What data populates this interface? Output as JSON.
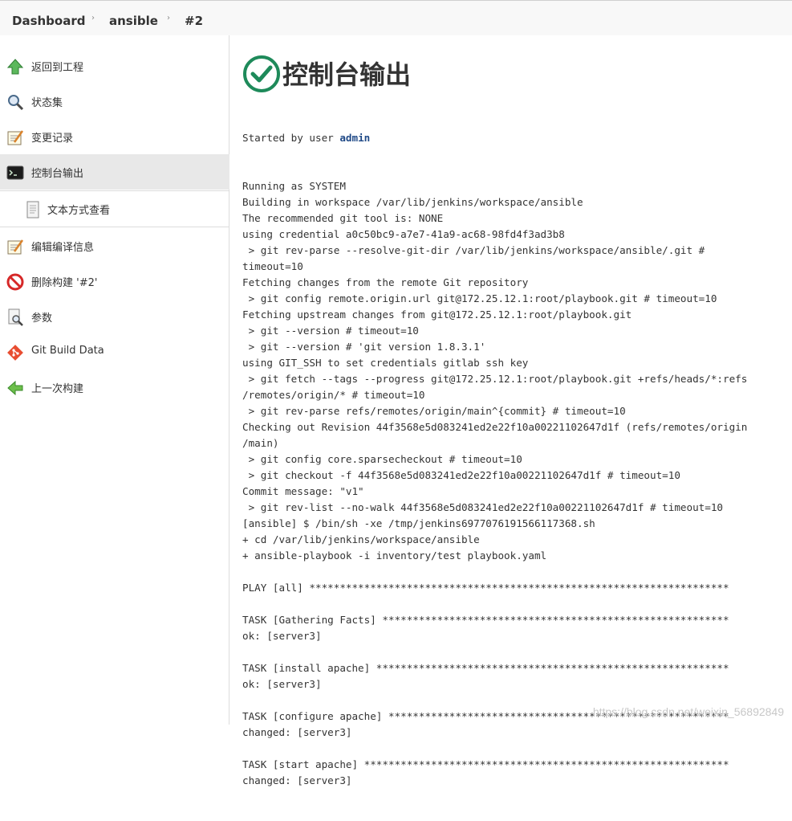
{
  "breadcrumb": {
    "items": [
      "Dashboard",
      "ansible",
      "#2"
    ],
    "separator": "›"
  },
  "sidebar": {
    "items": [
      {
        "label": "返回到工程",
        "icon": "up-arrow-icon"
      },
      {
        "label": "状态集",
        "icon": "magnifier-icon"
      },
      {
        "label": "变更记录",
        "icon": "notepad-icon"
      },
      {
        "label": "控制台输出",
        "icon": "terminal-icon",
        "active": true
      },
      {
        "label": "文本方式查看",
        "icon": "document-icon",
        "sub": true
      },
      {
        "label": "编辑编译信息",
        "icon": "edit-notepad-icon"
      },
      {
        "label": "删除构建 '#2'",
        "icon": "no-entry-icon"
      },
      {
        "label": "参数",
        "icon": "document-search-icon"
      },
      {
        "label": "Git Build Data",
        "icon": "git-icon"
      },
      {
        "label": "上一次构建",
        "icon": "back-arrow-icon"
      }
    ]
  },
  "main": {
    "title": "控制台输出",
    "status_icon": "success-check-icon",
    "status_color": "#1e8a5a",
    "started_by_prefix": "Started by user ",
    "started_by_user": "admin",
    "console_lines": [
      "Running as SYSTEM",
      "Building in workspace /var/lib/jenkins/workspace/ansible",
      "The recommended git tool is: NONE",
      "using credential a0c50bc9-a7e7-41a9-ac68-98fd4f3ad3b8",
      " > git rev-parse --resolve-git-dir /var/lib/jenkins/workspace/ansible/.git #",
      "timeout=10",
      "Fetching changes from the remote Git repository",
      " > git config remote.origin.url git@172.25.12.1:root/playbook.git # timeout=10",
      "Fetching upstream changes from git@172.25.12.1:root/playbook.git",
      " > git --version # timeout=10",
      " > git --version # 'git version 1.8.3.1'",
      "using GIT_SSH to set credentials gitlab ssh key",
      " > git fetch --tags --progress git@172.25.12.1:root/playbook.git +refs/heads/*:refs",
      "/remotes/origin/* # timeout=10",
      " > git rev-parse refs/remotes/origin/main^{commit} # timeout=10",
      "Checking out Revision 44f3568e5d083241ed2e22f10a00221102647d1f (refs/remotes/origin",
      "/main)",
      " > git config core.sparsecheckout # timeout=10",
      " > git checkout -f 44f3568e5d083241ed2e22f10a00221102647d1f # timeout=10",
      "Commit message: \"v1\"",
      " > git rev-list --no-walk 44f3568e5d083241ed2e22f10a00221102647d1f # timeout=10",
      "[ansible] $ /bin/sh -xe /tmp/jenkins6977076191566117368.sh",
      "+ cd /var/lib/jenkins/workspace/ansible",
      "+ ansible-playbook -i inventory/test playbook.yaml",
      "",
      "PLAY [all] *********************************************************************",
      "",
      "TASK [Gathering Facts] *********************************************************",
      "ok: [server3]",
      "",
      "TASK [install apache] **********************************************************",
      "ok: [server3]",
      "",
      "TASK [configure apache] ********************************************************",
      "changed: [server3]",
      "",
      "TASK [start apache] ************************************************************",
      "changed: [server3]"
    ]
  },
  "watermark": "https://blog.csdn.net/weixin_56892849"
}
